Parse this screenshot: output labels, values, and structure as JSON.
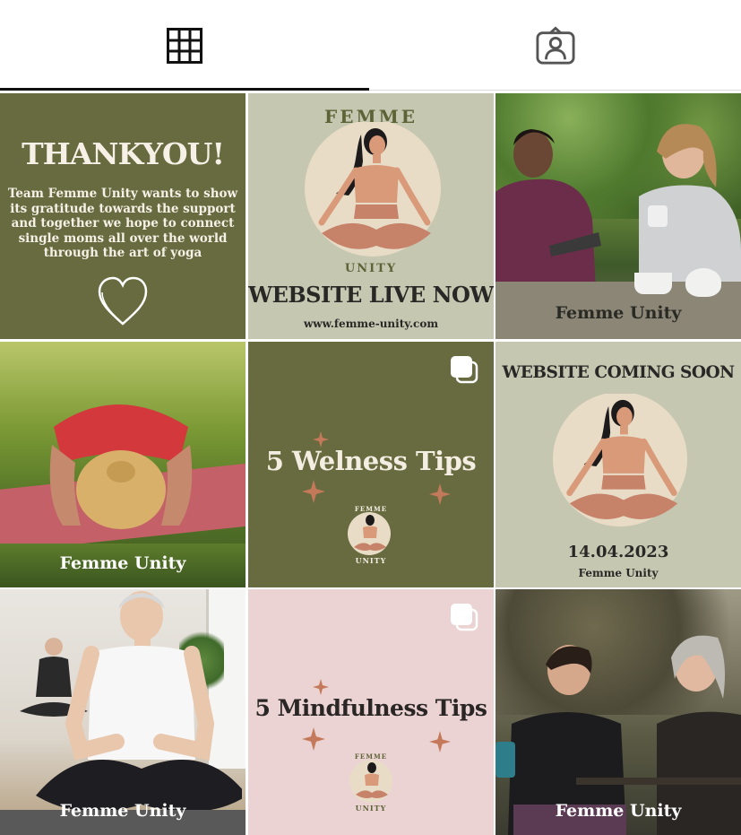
{
  "tabs": [
    {
      "label": "Posts",
      "icon": "grid-icon",
      "active": true
    },
    {
      "label": "Tagged",
      "icon": "tagged-person-icon",
      "active": false
    }
  ],
  "posts": [
    {
      "type": "text-graphic",
      "bg": "#676b3f",
      "headline": "THANKYOU!",
      "body": "Team Femme Unity wants to show its gratitude towards the support and together we hope to connect single moms all over the world through the art of yoga",
      "icon": "heart-icon"
    },
    {
      "type": "logo-announcement",
      "bg": "#c6c7b1",
      "brand_top": "FEMME",
      "brand_bottom": "UNITY",
      "headline": "WEBSITE LIVE NOW",
      "url": "www.femme-unity.com"
    },
    {
      "type": "photo",
      "scene": "two women chatting outdoors with tea",
      "brand": "Femme Unity"
    },
    {
      "type": "photo",
      "scene": "woman in child's pose on yoga mat in grass",
      "brand": "Femme Unity"
    },
    {
      "type": "carousel",
      "bg": "#676b3f",
      "headline": "5 Welness Tips",
      "logo_top": "FEMME",
      "logo_bottom": "UNITY"
    },
    {
      "type": "logo-announcement",
      "bg": "#c6c7b1",
      "headline": "WEBSITE COMING SOON",
      "date": "14.04.2023",
      "brand": "Femme Unity"
    },
    {
      "type": "photo",
      "scene": "older woman meditating cross-legged in studio",
      "brand": "Femme Unity"
    },
    {
      "type": "carousel",
      "bg": "#ecd3d3",
      "headline": "5 Mindfulness Tips",
      "logo_top": "FEMME",
      "logo_bottom": "UNITY"
    },
    {
      "type": "photo",
      "scene": "two smiling women leaning on a fence outdoors",
      "brand": "Femme Unity"
    }
  ],
  "colors": {
    "olive": "#676b3f",
    "sage": "#c6c7b1",
    "blush": "#ecd3d3",
    "terracotta": "#d99a7a",
    "cream": "#e8dcc7"
  }
}
